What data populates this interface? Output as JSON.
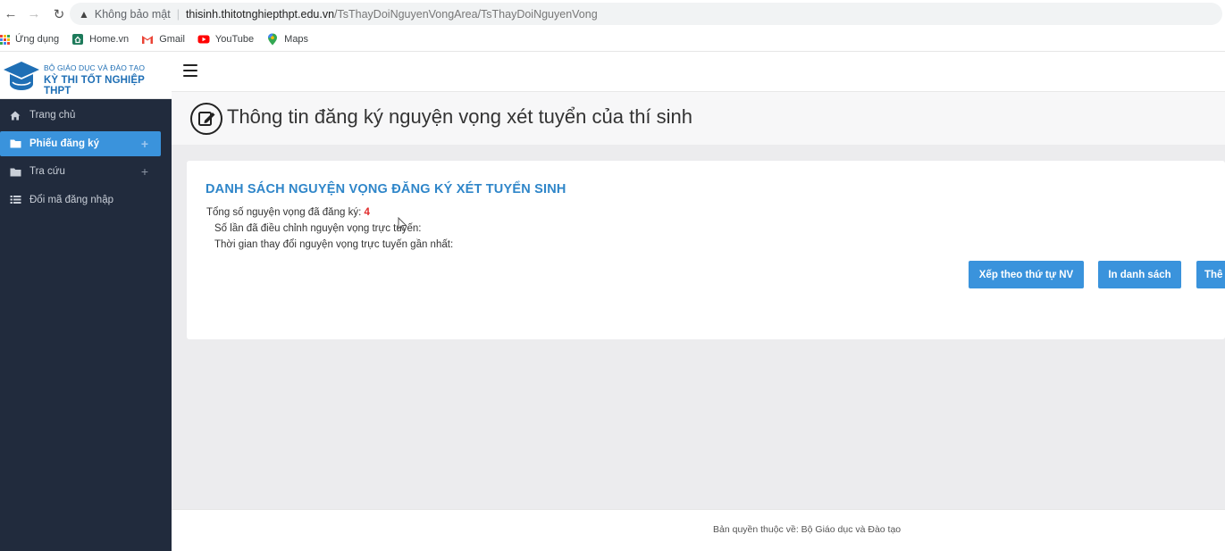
{
  "browser": {
    "security_label": "Không bảo mật",
    "url_host": "thisinh.thitotnghiepthpt.edu.vn",
    "url_path": "/TsThayDoiNguyenVongArea/TsThayDoiNguyenVong",
    "bookmarks": [
      "Ứng dụng",
      "Home.vn",
      "Gmail",
      "YouTube",
      "Maps"
    ]
  },
  "brand": {
    "top_line": "BỘ GIÁO DỤC VÀ ĐÀO TẠO",
    "main_line": "KỲ THI TỐT NGHIỆP THPT"
  },
  "sidebar": {
    "items": [
      {
        "label": "Trang chủ",
        "icon": "home-icon"
      },
      {
        "label": "Phiếu đăng ký",
        "icon": "folder-icon",
        "active": true
      },
      {
        "label": "Tra cứu",
        "icon": "folder-icon"
      },
      {
        "label": "Đổi mã đăng nhập",
        "icon": "list-icon"
      }
    ],
    "expand_symbol": "+"
  },
  "page": {
    "title": "Thông tin đăng ký nguyện vọng xét tuyển của thí sinh"
  },
  "card": {
    "title": "DANH SÁCH NGUYỆN VỌNG ĐĂNG KÝ XÉT TUYỂN SINH",
    "total_label": "Tổng số nguyện vọng đã đăng ký:",
    "total_value": "4",
    "edit_count_label": "Số lần đã điều chỉnh nguyện vọng trực tuyến:",
    "last_change_label": "Thời gian thay đổi nguyện vọng trực tuyến gần nhất:",
    "buttons": {
      "sort": "Xếp theo thứ tự NV",
      "print": "In danh sách",
      "add_partial": "Thê"
    }
  },
  "footer": {
    "copyright": "Bản quyền thuộc về: Bộ Giáo dục và Đào tạo"
  },
  "colors": {
    "sidebar_bg": "#212b3d",
    "accent": "#3a93dc",
    "title_blue": "#2f86c9",
    "count_red": "#e02b2b"
  }
}
